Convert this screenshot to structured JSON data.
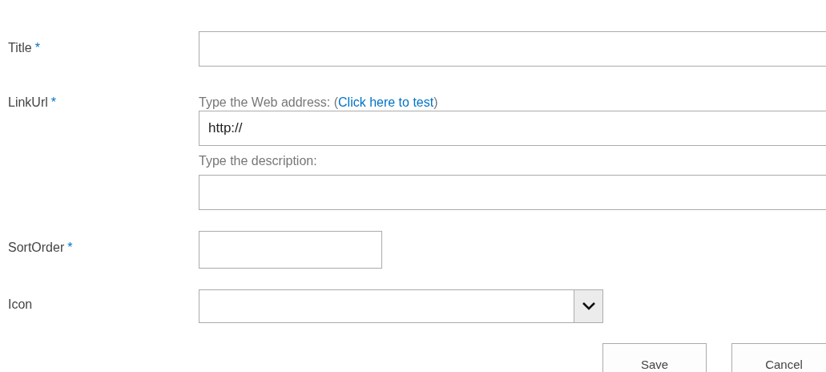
{
  "fields": [
    {
      "kind": "text",
      "label": "Title",
      "required_mark": "*"
    },
    {
      "kind": "url",
      "label": "LinkUrl",
      "required_mark": "*",
      "address_hint": "Type the Web address: (",
      "test_link": "Click here to test",
      "address_hint_end": ")",
      "value": "http://",
      "description_hint": "Type the description:"
    },
    {
      "kind": "short",
      "label": "SortOrder",
      "required_mark": "*"
    },
    {
      "kind": "select",
      "label": "Icon"
    }
  ],
  "buttons": [
    {
      "label": "Save"
    },
    {
      "label": "Cancel"
    }
  ]
}
